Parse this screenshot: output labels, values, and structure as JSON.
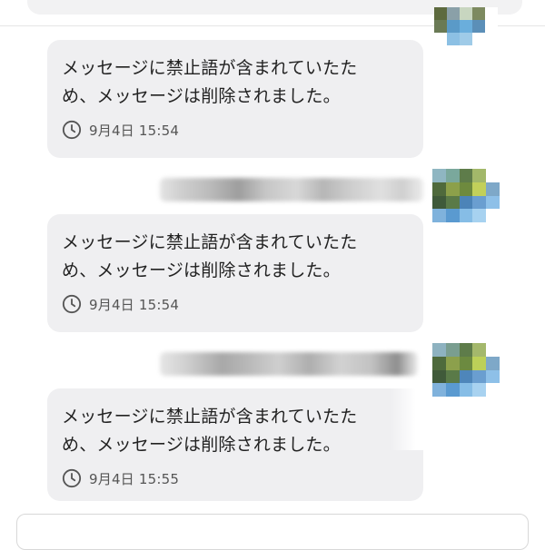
{
  "messages": [
    {
      "text": "メッセージに禁止語が含まれていたた\nめ、メッセージは削除されました。",
      "time": "9月4日 15:54"
    },
    {
      "text": "メッセージに禁止語が含まれていたた\nめ、メッセージは削除されました。",
      "time": "9月4日 15:54"
    },
    {
      "text": "メッセージに禁止語が含まれていたた\nめ、メッセージは削除されました。",
      "time": "9月4日 15:55"
    }
  ],
  "icons": {
    "timestamp": "clock-icon"
  },
  "colors": {
    "bubble_bg": "#efeff1",
    "text": "#222222",
    "meta_text": "#555555"
  }
}
